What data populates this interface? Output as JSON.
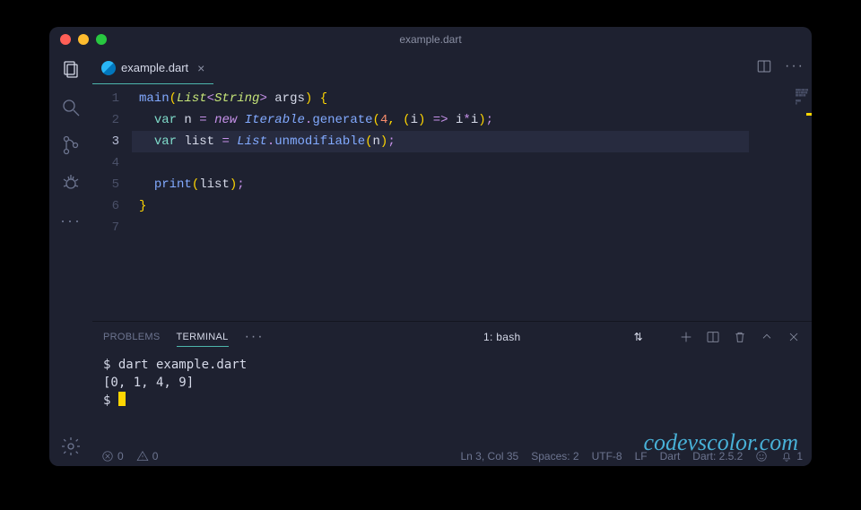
{
  "window": {
    "title": "example.dart"
  },
  "tab": {
    "filename": "example.dart"
  },
  "code": {
    "lines": [
      {
        "n": 1,
        "tokens": [
          {
            "t": "main",
            "c": "tok-fn"
          },
          {
            "t": "(",
            "c": "tok-br"
          },
          {
            "t": "List",
            "c": "tok-typec"
          },
          {
            "t": "<",
            "c": "tok-pun"
          },
          {
            "t": "String",
            "c": "tok-typec"
          },
          {
            "t": ">",
            "c": "tok-pun"
          },
          {
            "t": " args",
            "c": "tok-var"
          },
          {
            "t": ") ",
            "c": "tok-br"
          },
          {
            "t": "{",
            "c": "tok-br"
          }
        ]
      },
      {
        "n": 2,
        "tokens": [
          {
            "t": "  ",
            "c": ""
          },
          {
            "t": "var",
            "c": "tok-kw"
          },
          {
            "t": " n ",
            "c": "tok-var"
          },
          {
            "t": "=",
            "c": "tok-op"
          },
          {
            "t": " ",
            "c": ""
          },
          {
            "t": "new",
            "c": "tok-new"
          },
          {
            "t": " ",
            "c": ""
          },
          {
            "t": "Iterable",
            "c": "tok-type"
          },
          {
            "t": ".",
            "c": "tok-pun"
          },
          {
            "t": "generate",
            "c": "tok-fn"
          },
          {
            "t": "(",
            "c": "tok-br"
          },
          {
            "t": "4",
            "c": "tok-num"
          },
          {
            "t": ", (",
            "c": "tok-br"
          },
          {
            "t": "i",
            "c": "tok-var"
          },
          {
            "t": ") ",
            "c": "tok-br"
          },
          {
            "t": "=>",
            "c": "tok-op"
          },
          {
            "t": " i",
            "c": "tok-var"
          },
          {
            "t": "*",
            "c": "tok-op"
          },
          {
            "t": "i",
            "c": "tok-var"
          },
          {
            "t": ")",
            "c": "tok-br"
          },
          {
            "t": ";",
            "c": "tok-pun"
          }
        ]
      },
      {
        "n": 3,
        "hl": true,
        "tokens": [
          {
            "t": "  ",
            "c": ""
          },
          {
            "t": "var",
            "c": "tok-kw"
          },
          {
            "t": " list ",
            "c": "tok-var"
          },
          {
            "t": "=",
            "c": "tok-op"
          },
          {
            "t": " ",
            "c": ""
          },
          {
            "t": "List",
            "c": "tok-type"
          },
          {
            "t": ".",
            "c": "tok-pun"
          },
          {
            "t": "unmodifiable",
            "c": "tok-fn"
          },
          {
            "t": "(",
            "c": "tok-br"
          },
          {
            "t": "n",
            "c": "tok-var"
          },
          {
            "t": ")",
            "c": "tok-br"
          },
          {
            "t": ";",
            "c": "tok-pun"
          }
        ]
      },
      {
        "n": 4,
        "tokens": []
      },
      {
        "n": 5,
        "tokens": [
          {
            "t": "  ",
            "c": ""
          },
          {
            "t": "print",
            "c": "tok-fn"
          },
          {
            "t": "(",
            "c": "tok-br"
          },
          {
            "t": "list",
            "c": "tok-var"
          },
          {
            "t": ")",
            "c": "tok-br"
          },
          {
            "t": ";",
            "c": "tok-pun"
          }
        ]
      },
      {
        "n": 6,
        "tokens": [
          {
            "t": "}",
            "c": "tok-br"
          }
        ]
      },
      {
        "n": 7,
        "tokens": []
      }
    ]
  },
  "panel": {
    "tabs": {
      "problems": "PROBLEMS",
      "terminal": "TERMINAL"
    },
    "more": "···",
    "select": "1: bash",
    "terminal_lines": [
      "$ dart example.dart",
      "[0, 1, 4, 9]",
      "$ "
    ]
  },
  "status": {
    "errors": "0",
    "warnings": "0",
    "lncol": "Ln 3, Col 35",
    "spaces": "Spaces: 2",
    "encoding": "UTF-8",
    "eol": "LF",
    "lang": "Dart",
    "sdk": "Dart: 2.5.2",
    "bell": "1"
  },
  "watermark": "codevscolor.com"
}
